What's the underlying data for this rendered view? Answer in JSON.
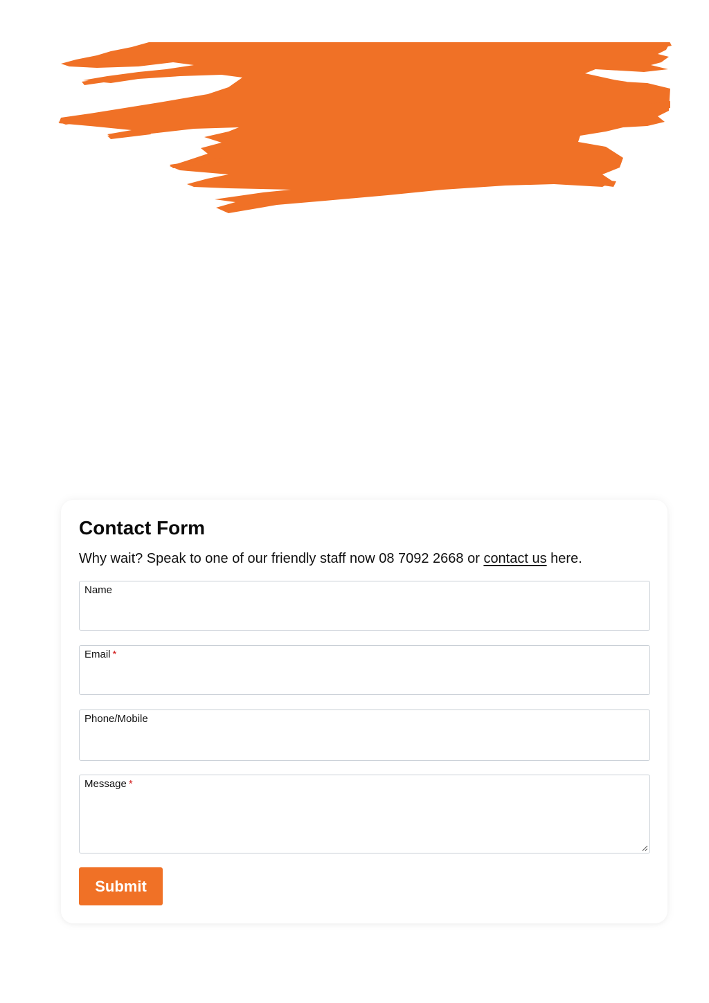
{
  "brand": {
    "accent_color": "#f07126"
  },
  "contact_form": {
    "title": "Contact Form",
    "intro_before_link": "Why wait? Speak to one of our friendly staff now 08 7092 2668 or ",
    "intro_link_text": "contact us",
    "intro_after_link": " here.",
    "required_marker": "*",
    "fields": {
      "name": {
        "label": "Name",
        "value": "",
        "required": false
      },
      "email": {
        "label": "Email",
        "value": "",
        "required": true
      },
      "phone": {
        "label": "Phone/Mobile",
        "value": "",
        "required": false
      },
      "message": {
        "label": "Message",
        "value": "",
        "required": true
      }
    },
    "submit_label": "Submit"
  },
  "decorations": {
    "brush_stroke_icon": "paint-brush-stroke"
  }
}
